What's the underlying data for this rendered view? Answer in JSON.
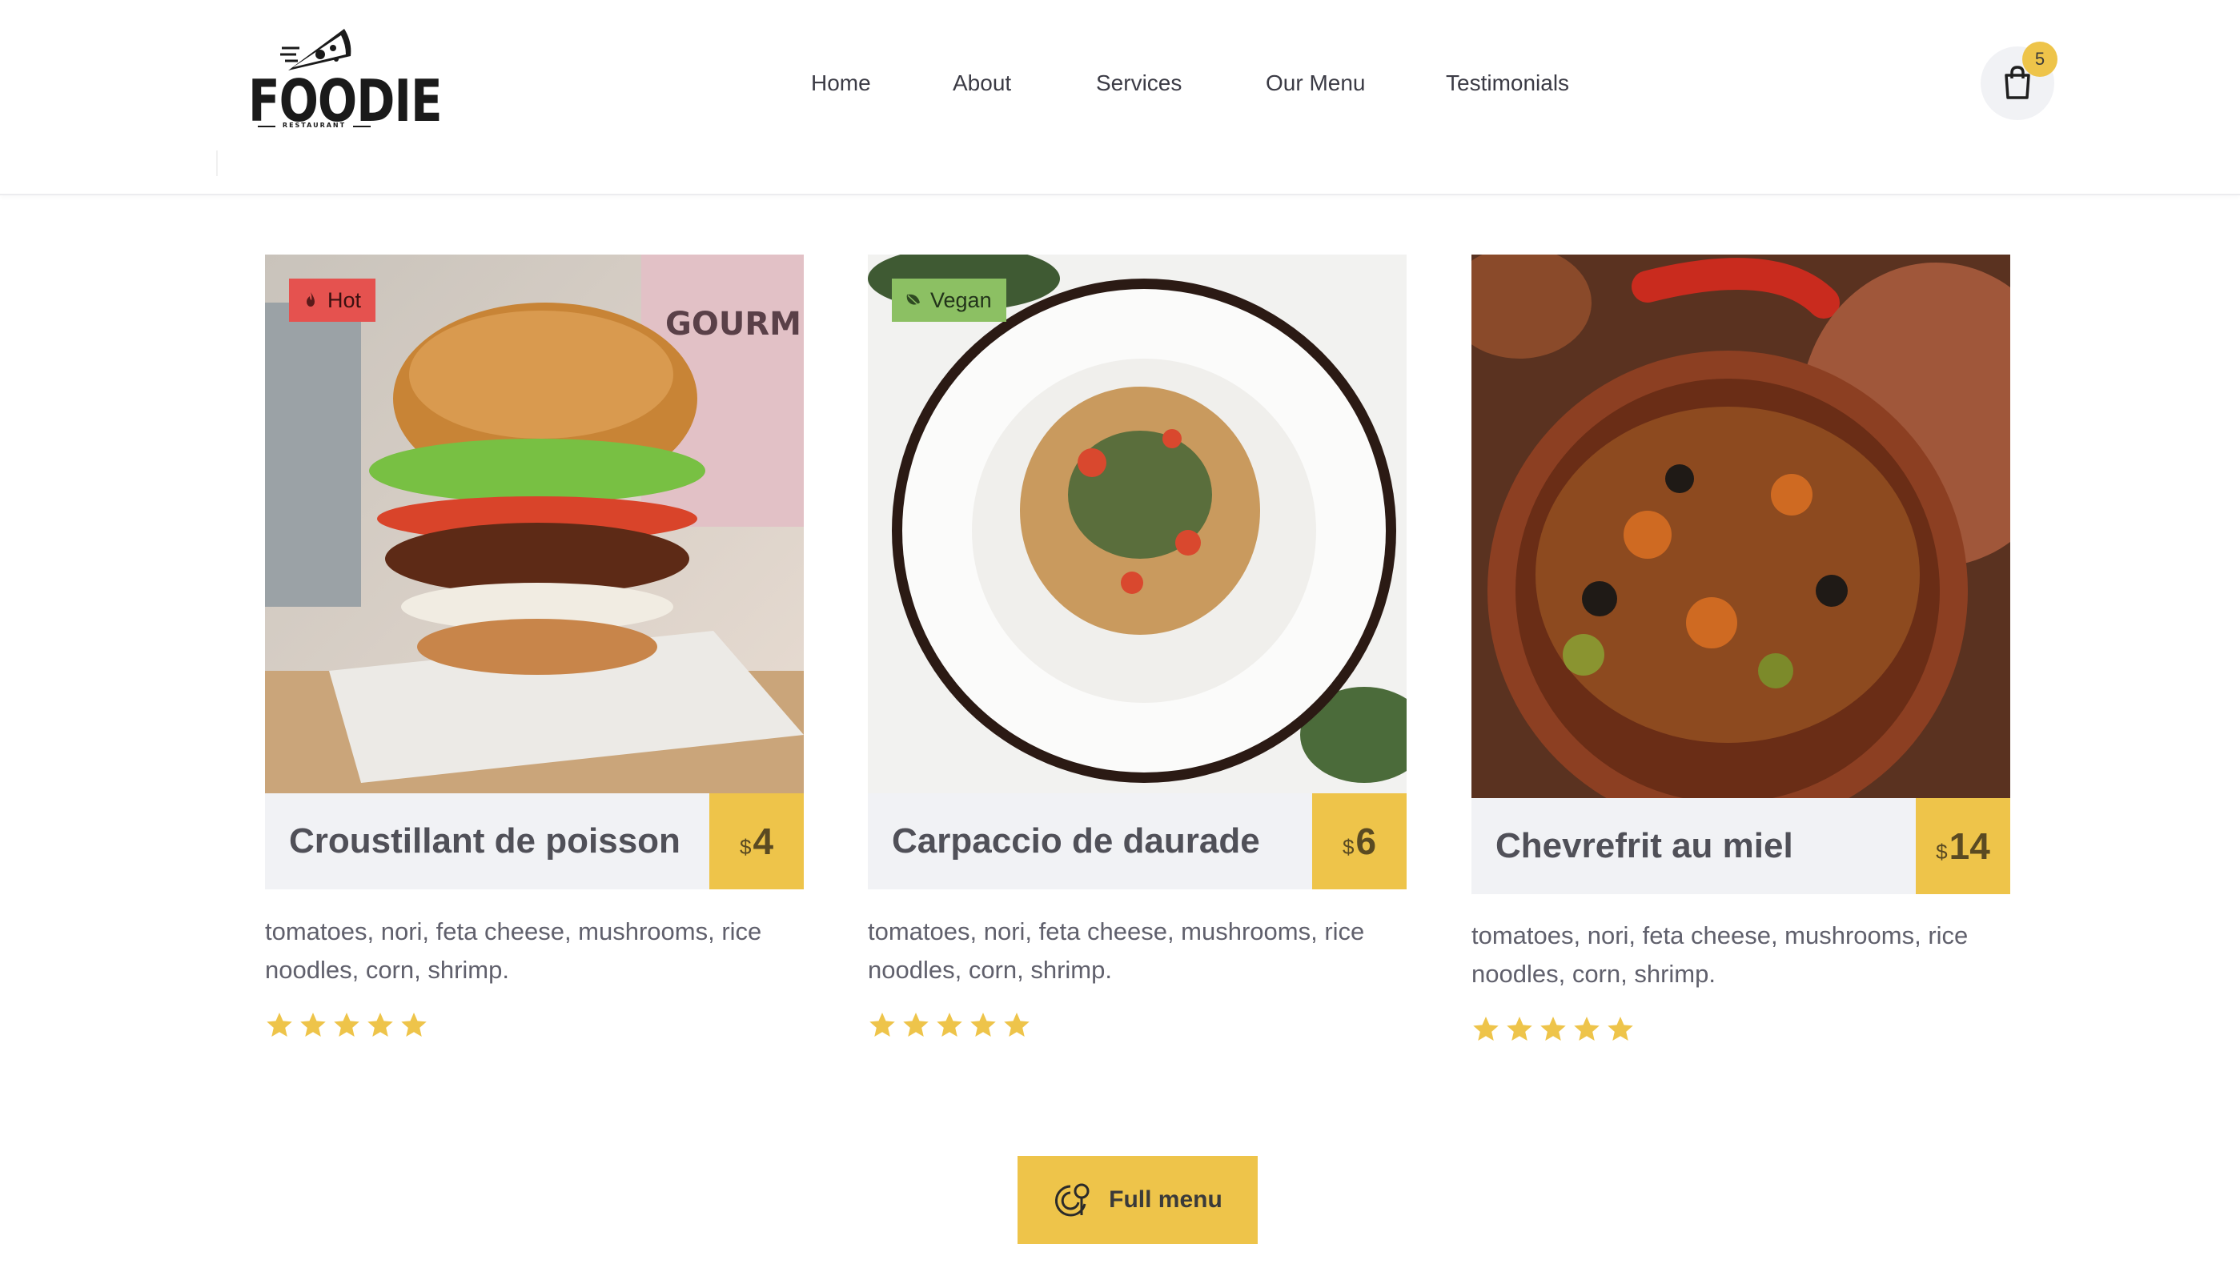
{
  "brand": {
    "name": "FOODIE",
    "tagline": "RESTAURANT"
  },
  "nav": {
    "items": [
      {
        "label": "Home"
      },
      {
        "label": "About"
      },
      {
        "label": "Services"
      },
      {
        "label": "Our Menu"
      },
      {
        "label": "Testimonials"
      }
    ]
  },
  "cart": {
    "count": "5",
    "icon": "shopping-bag-icon"
  },
  "menu_items": [
    {
      "name": "Croustillant de poisson",
      "badge": "Hot",
      "badge_icon": "flame-icon",
      "currency": "$",
      "price": "4",
      "description": "tomatoes, nori, feta cheese, mushrooms, rice noodles, corn, shrimp.",
      "rating": 5,
      "image": "burger-photo"
    },
    {
      "name": "Carpaccio de daurade",
      "badge": "Vegan",
      "badge_icon": "leaf-icon",
      "currency": "$",
      "price": "6",
      "description": "tomatoes, nori, feta cheese, mushrooms, rice noodles, corn, shrimp.",
      "rating": 5,
      "image": "pasta-plate-photo"
    },
    {
      "name": "Chevrefrit au miel",
      "badge": "",
      "currency": "$",
      "price": "14",
      "description": "tomatoes, nori, feta cheese, mushrooms, rice noodles, corn, shrimp.",
      "rating": 5,
      "image": "tagine-stew-photo"
    }
  ],
  "cta": {
    "label": "Full menu",
    "icon": "dish-icon"
  },
  "colors": {
    "accent": "#eec44a",
    "hot": "#e5524f",
    "vegan": "#8cc063",
    "title_bar": "#f1f2f5",
    "text": "#505058"
  }
}
